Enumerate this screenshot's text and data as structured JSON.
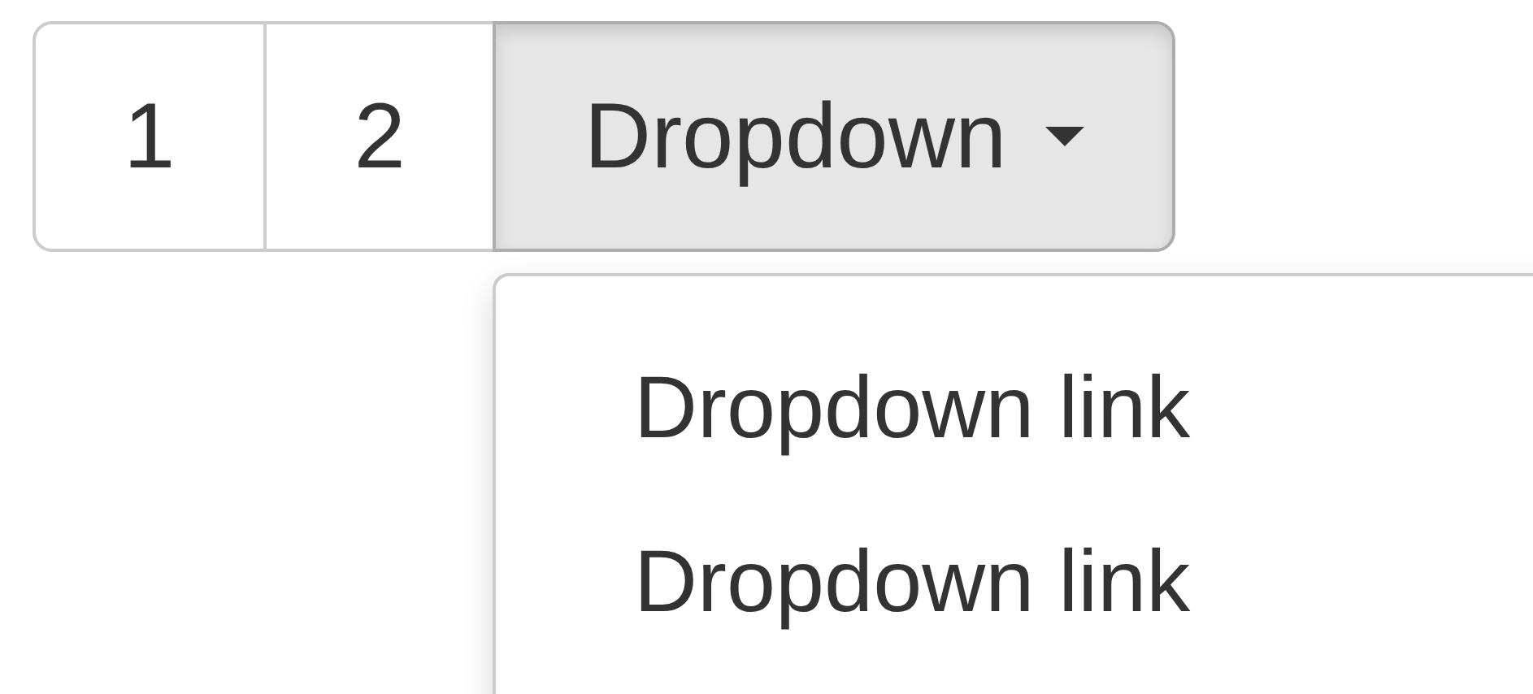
{
  "button_group": {
    "buttons": [
      {
        "kind": "button",
        "label": "1",
        "selected": false
      },
      {
        "kind": "button",
        "label": "2",
        "selected": false
      },
      {
        "kind": "dropdown",
        "label": "Dropdown",
        "expanded": true
      }
    ]
  },
  "dropdown_menu": {
    "items": [
      "Dropdown link",
      "Dropdown link"
    ]
  }
}
